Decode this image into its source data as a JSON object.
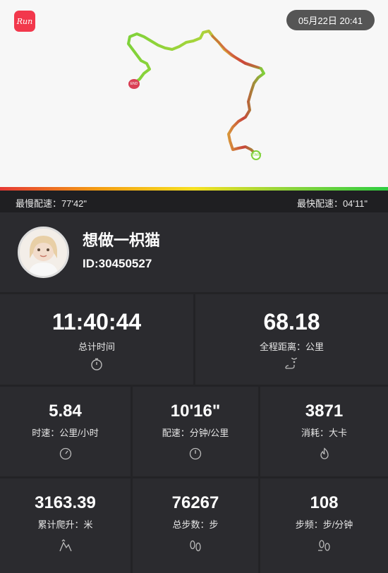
{
  "header": {
    "logo_text": "Run",
    "datetime": "05月22日 20:41"
  },
  "pace_bar": {
    "slowest": "最慢配速：77'42\"",
    "fastest": "最快配速：04'11\""
  },
  "map": {
    "start_marker": "START",
    "end_marker": "END"
  },
  "profile": {
    "name": "想做一枳猫",
    "id": "ID:30450527"
  },
  "stats": {
    "total_time": {
      "value": "11:40:44",
      "label": "总计时间"
    },
    "distance": {
      "value": "68.18",
      "label": "全程距离：公里"
    },
    "speed": {
      "value": "5.84",
      "label": "时速：公里/小时"
    },
    "pace": {
      "value": "10'16\"",
      "label": "配速：分钟/公里"
    },
    "calories": {
      "value": "3871",
      "label": "消耗：大卡"
    },
    "climb": {
      "value": "3163.39",
      "label": "累计爬升：米"
    },
    "steps": {
      "value": "76267",
      "label": "总步数：步"
    },
    "cadence": {
      "value": "108",
      "label": "步频：步/分钟"
    }
  },
  "colors": {
    "slow": "#e53935",
    "fast": "#2ecc40",
    "panel": "#2b2b2f"
  }
}
